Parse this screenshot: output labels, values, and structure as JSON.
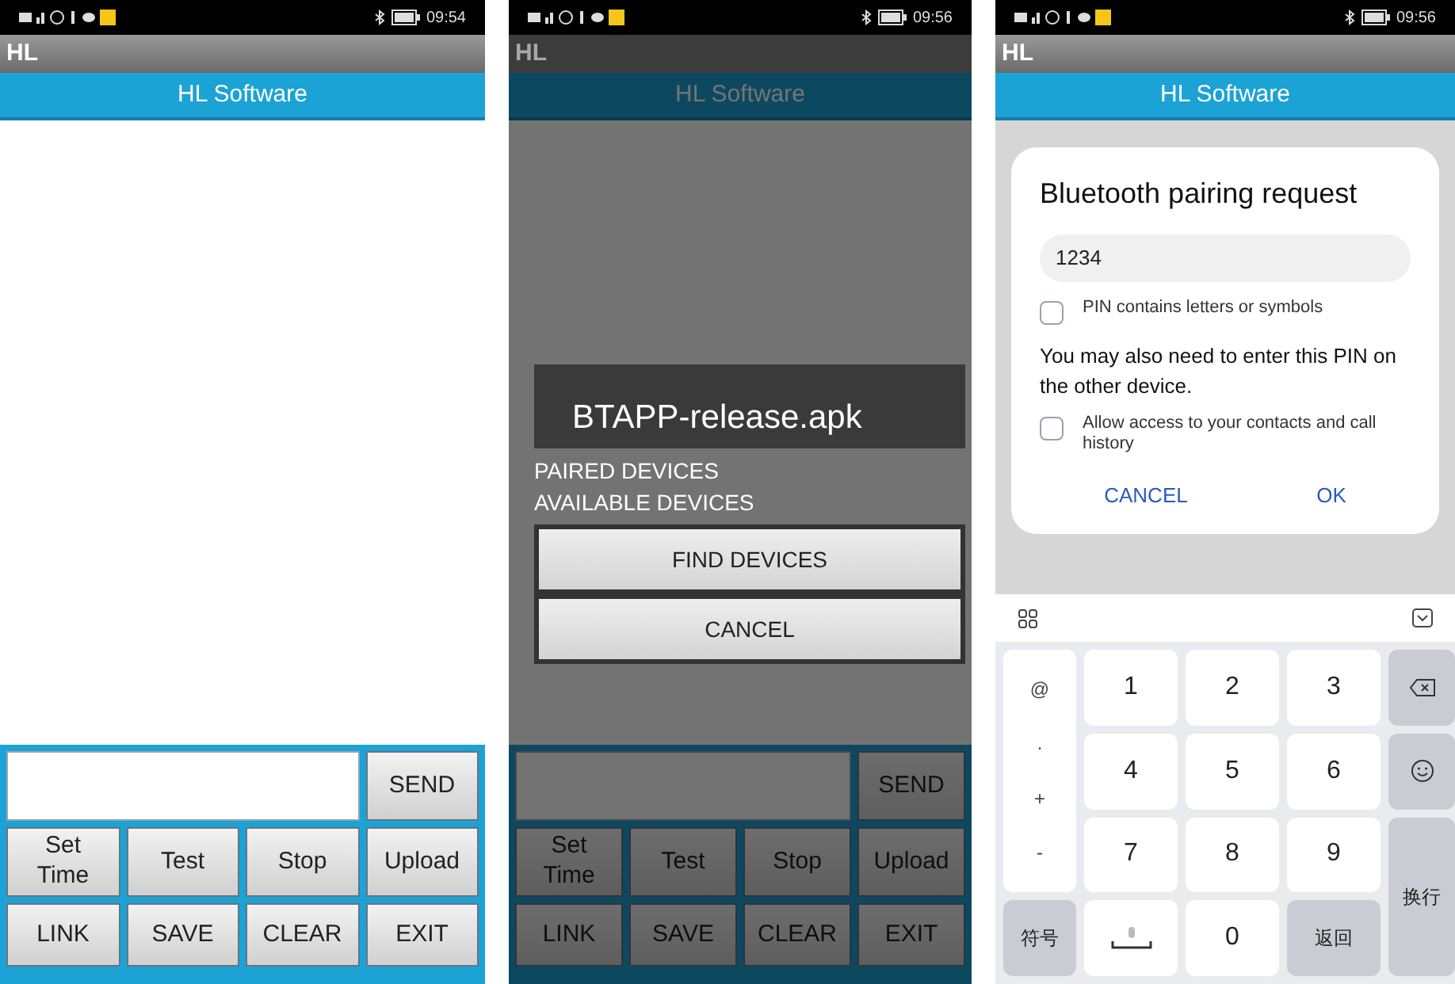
{
  "screens": [
    {
      "kind": "main",
      "dimmed": false,
      "time": "09:54",
      "app_bar": "HL",
      "header": "HL Software",
      "send": "SEND",
      "buttons": [
        "Set Time",
        "Test",
        "Stop",
        "Upload",
        "LINK",
        "SAVE",
        "CLEAR",
        "EXIT"
      ]
    },
    {
      "kind": "main",
      "dimmed": true,
      "time": "09:56",
      "app_bar": "HL",
      "header": "HL Software",
      "send": "SEND",
      "buttons": [
        "Set Time",
        "Test",
        "Stop",
        "Upload",
        "LINK",
        "SAVE",
        "CLEAR",
        "EXIT"
      ],
      "dialog": {
        "title": "BTAPP-release.apk",
        "labels": [
          "PAIRED DEVICES",
          "AVAILABLE DEVICES"
        ],
        "buttons": [
          "FIND DEVICES",
          "CANCEL"
        ]
      }
    },
    {
      "kind": "pairing",
      "time": "09:56",
      "app_bar": "HL",
      "header": "HL Software",
      "dialog": {
        "title": "Bluetooth pairing request",
        "pin": "1234",
        "options": [
          {
            "label": "PIN contains letters or symbols",
            "checked": false
          },
          {
            "label": "Allow access to your contacts and call history",
            "checked": false
          }
        ],
        "note": "You may also need to enter this PIN on the other device.",
        "actions": [
          "CANCEL",
          "OK"
        ]
      },
      "keyboard": {
        "side_keys": [
          "@",
          ".",
          "+",
          "-"
        ],
        "digits": [
          "1",
          "2",
          "3",
          "4",
          "5",
          "6",
          "7",
          "8",
          "9"
        ],
        "symbols": "符号",
        "zero": "0",
        "back": "返回",
        "enter": "换行"
      }
    }
  ]
}
